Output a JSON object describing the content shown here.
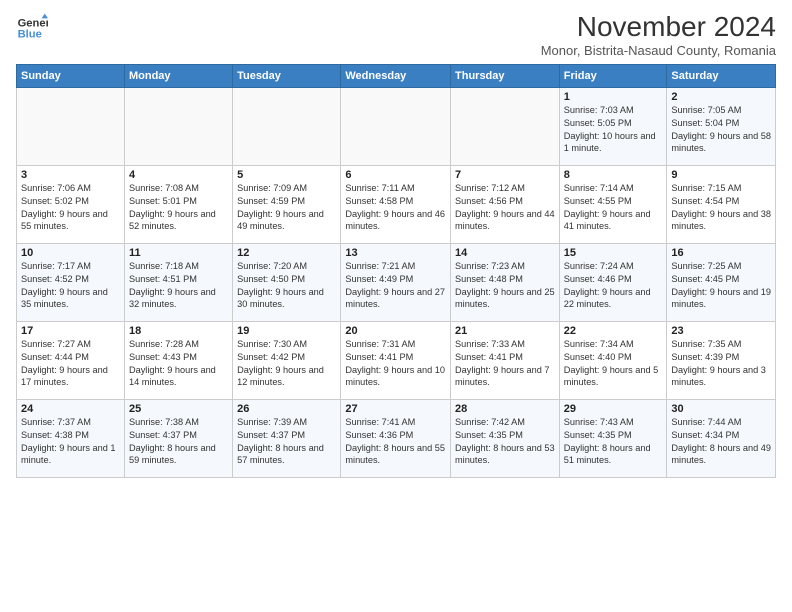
{
  "logo": {
    "line1": "General",
    "line2": "Blue"
  },
  "title": "November 2024",
  "subtitle": "Monor, Bistrita-Nasaud County, Romania",
  "weekdays": [
    "Sunday",
    "Monday",
    "Tuesday",
    "Wednesday",
    "Thursday",
    "Friday",
    "Saturday"
  ],
  "weeks": [
    [
      {
        "day": "",
        "detail": ""
      },
      {
        "day": "",
        "detail": ""
      },
      {
        "day": "",
        "detail": ""
      },
      {
        "day": "",
        "detail": ""
      },
      {
        "day": "",
        "detail": ""
      },
      {
        "day": "1",
        "detail": "Sunrise: 7:03 AM\nSunset: 5:05 PM\nDaylight: 10 hours and 1 minute."
      },
      {
        "day": "2",
        "detail": "Sunrise: 7:05 AM\nSunset: 5:04 PM\nDaylight: 9 hours and 58 minutes."
      }
    ],
    [
      {
        "day": "3",
        "detail": "Sunrise: 7:06 AM\nSunset: 5:02 PM\nDaylight: 9 hours and 55 minutes."
      },
      {
        "day": "4",
        "detail": "Sunrise: 7:08 AM\nSunset: 5:01 PM\nDaylight: 9 hours and 52 minutes."
      },
      {
        "day": "5",
        "detail": "Sunrise: 7:09 AM\nSunset: 4:59 PM\nDaylight: 9 hours and 49 minutes."
      },
      {
        "day": "6",
        "detail": "Sunrise: 7:11 AM\nSunset: 4:58 PM\nDaylight: 9 hours and 46 minutes."
      },
      {
        "day": "7",
        "detail": "Sunrise: 7:12 AM\nSunset: 4:56 PM\nDaylight: 9 hours and 44 minutes."
      },
      {
        "day": "8",
        "detail": "Sunrise: 7:14 AM\nSunset: 4:55 PM\nDaylight: 9 hours and 41 minutes."
      },
      {
        "day": "9",
        "detail": "Sunrise: 7:15 AM\nSunset: 4:54 PM\nDaylight: 9 hours and 38 minutes."
      }
    ],
    [
      {
        "day": "10",
        "detail": "Sunrise: 7:17 AM\nSunset: 4:52 PM\nDaylight: 9 hours and 35 minutes."
      },
      {
        "day": "11",
        "detail": "Sunrise: 7:18 AM\nSunset: 4:51 PM\nDaylight: 9 hours and 32 minutes."
      },
      {
        "day": "12",
        "detail": "Sunrise: 7:20 AM\nSunset: 4:50 PM\nDaylight: 9 hours and 30 minutes."
      },
      {
        "day": "13",
        "detail": "Sunrise: 7:21 AM\nSunset: 4:49 PM\nDaylight: 9 hours and 27 minutes."
      },
      {
        "day": "14",
        "detail": "Sunrise: 7:23 AM\nSunset: 4:48 PM\nDaylight: 9 hours and 25 minutes."
      },
      {
        "day": "15",
        "detail": "Sunrise: 7:24 AM\nSunset: 4:46 PM\nDaylight: 9 hours and 22 minutes."
      },
      {
        "day": "16",
        "detail": "Sunrise: 7:25 AM\nSunset: 4:45 PM\nDaylight: 9 hours and 19 minutes."
      }
    ],
    [
      {
        "day": "17",
        "detail": "Sunrise: 7:27 AM\nSunset: 4:44 PM\nDaylight: 9 hours and 17 minutes."
      },
      {
        "day": "18",
        "detail": "Sunrise: 7:28 AM\nSunset: 4:43 PM\nDaylight: 9 hours and 14 minutes."
      },
      {
        "day": "19",
        "detail": "Sunrise: 7:30 AM\nSunset: 4:42 PM\nDaylight: 9 hours and 12 minutes."
      },
      {
        "day": "20",
        "detail": "Sunrise: 7:31 AM\nSunset: 4:41 PM\nDaylight: 9 hours and 10 minutes."
      },
      {
        "day": "21",
        "detail": "Sunrise: 7:33 AM\nSunset: 4:41 PM\nDaylight: 9 hours and 7 minutes."
      },
      {
        "day": "22",
        "detail": "Sunrise: 7:34 AM\nSunset: 4:40 PM\nDaylight: 9 hours and 5 minutes."
      },
      {
        "day": "23",
        "detail": "Sunrise: 7:35 AM\nSunset: 4:39 PM\nDaylight: 9 hours and 3 minutes."
      }
    ],
    [
      {
        "day": "24",
        "detail": "Sunrise: 7:37 AM\nSunset: 4:38 PM\nDaylight: 9 hours and 1 minute."
      },
      {
        "day": "25",
        "detail": "Sunrise: 7:38 AM\nSunset: 4:37 PM\nDaylight: 8 hours and 59 minutes."
      },
      {
        "day": "26",
        "detail": "Sunrise: 7:39 AM\nSunset: 4:37 PM\nDaylight: 8 hours and 57 minutes."
      },
      {
        "day": "27",
        "detail": "Sunrise: 7:41 AM\nSunset: 4:36 PM\nDaylight: 8 hours and 55 minutes."
      },
      {
        "day": "28",
        "detail": "Sunrise: 7:42 AM\nSunset: 4:35 PM\nDaylight: 8 hours and 53 minutes."
      },
      {
        "day": "29",
        "detail": "Sunrise: 7:43 AM\nSunset: 4:35 PM\nDaylight: 8 hours and 51 minutes."
      },
      {
        "day": "30",
        "detail": "Sunrise: 7:44 AM\nSunset: 4:34 PM\nDaylight: 8 hours and 49 minutes."
      }
    ]
  ]
}
